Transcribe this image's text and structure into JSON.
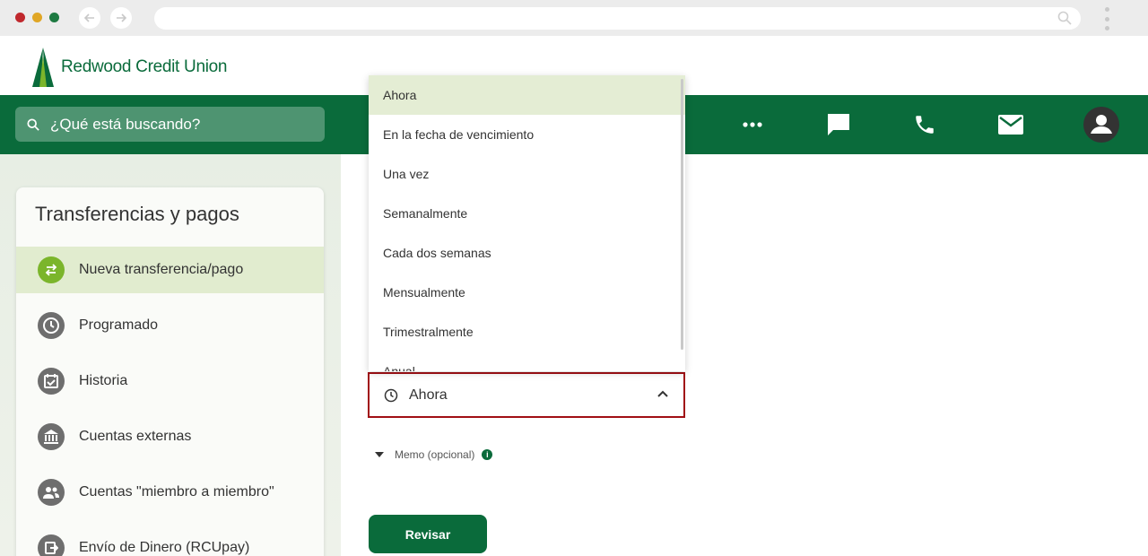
{
  "browser": {
    "window_controls": [
      "close",
      "minimize",
      "maximize"
    ],
    "icons": [
      "back-arrow-icon",
      "forward-arrow-icon",
      "search-icon",
      "kebab-menu-icon"
    ]
  },
  "header": {
    "logo_text": "Redwood Credit Union",
    "search_placeholder": "¿Qué está buscando?",
    "actions": [
      {
        "name": "more",
        "icon": "more-horizontal-icon"
      },
      {
        "name": "chat",
        "icon": "chat-bubble-icon"
      },
      {
        "name": "phone",
        "icon": "phone-icon"
      },
      {
        "name": "mail",
        "icon": "mail-icon"
      },
      {
        "name": "profile",
        "icon": "account-icon"
      }
    ]
  },
  "sidebar": {
    "title": "Transferencias y pagos",
    "items": [
      {
        "label": "Nueva transferencia/pago",
        "icon": "swap-arrows-icon",
        "active": true
      },
      {
        "label": "Programado",
        "icon": "clock-icon",
        "active": false
      },
      {
        "label": "Historia",
        "icon": "calendar-check-icon",
        "active": false
      },
      {
        "label": "Cuentas externas",
        "icon": "bank-icon",
        "active": false
      },
      {
        "label": "Cuentas \"miembro a miembro\"",
        "icon": "people-icon",
        "active": false
      },
      {
        "label": "Envío de Dinero (RCUpay)",
        "icon": "send-money-icon",
        "active": false
      }
    ]
  },
  "frequency": {
    "selected": "Ahora",
    "options": [
      "Ahora",
      "En la fecha de vencimiento",
      "Una vez",
      "Semanalmente",
      "Cada dos semanas",
      "Mensualmente",
      "Trimestralmente",
      "Anual"
    ]
  },
  "memo": {
    "label": "Memo (opcional)",
    "info_icon": "i"
  },
  "review_button": "Revisar",
  "colors": {
    "brand_green": "#0a6b3b",
    "active_green": "#7bb52b",
    "highlight": "#e1eccf",
    "focus_border": "#a10f14"
  }
}
